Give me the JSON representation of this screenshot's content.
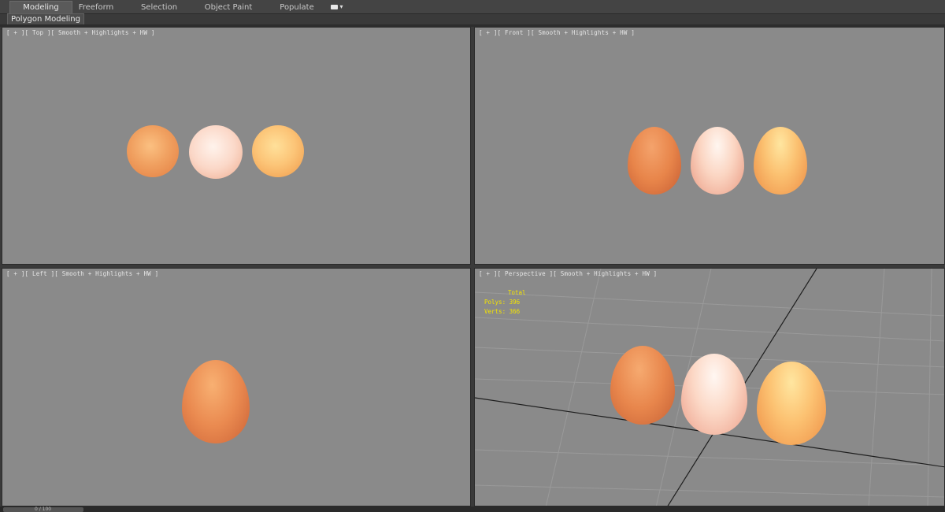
{
  "ribbon": {
    "tabs": [
      {
        "label": "Modeling",
        "active": true
      },
      {
        "label": "Freeform",
        "active": false
      },
      {
        "label": "Selection",
        "active": false
      },
      {
        "label": "Object Paint",
        "active": false
      },
      {
        "label": "Populate",
        "active": false
      }
    ],
    "panel_label": "Polygon Modeling"
  },
  "viewports": {
    "top": {
      "label": "[ + ][ Top ][ Smooth + Highlights + HW ]"
    },
    "front": {
      "label": "[ + ][ Front ][ Smooth + Highlights + HW ]"
    },
    "left": {
      "label": "[ + ][ Left ][ Smooth + Highlights + HW ]"
    },
    "perspective": {
      "label": "[ + ][ Perspective ][ Smooth + Highlights + HW ]",
      "stats": {
        "header": "Total",
        "polys": "Polys: 396",
        "verts": "Verts: 366"
      }
    }
  },
  "timeline": {
    "text": "0 / 100"
  },
  "colors": {
    "viewport_bg": "#8a8a8a",
    "stats_text": "#f4e400",
    "egg_orange": "#e8854a",
    "egg_pink": "#f6c9b8",
    "egg_yellow": "#f8b55a"
  }
}
